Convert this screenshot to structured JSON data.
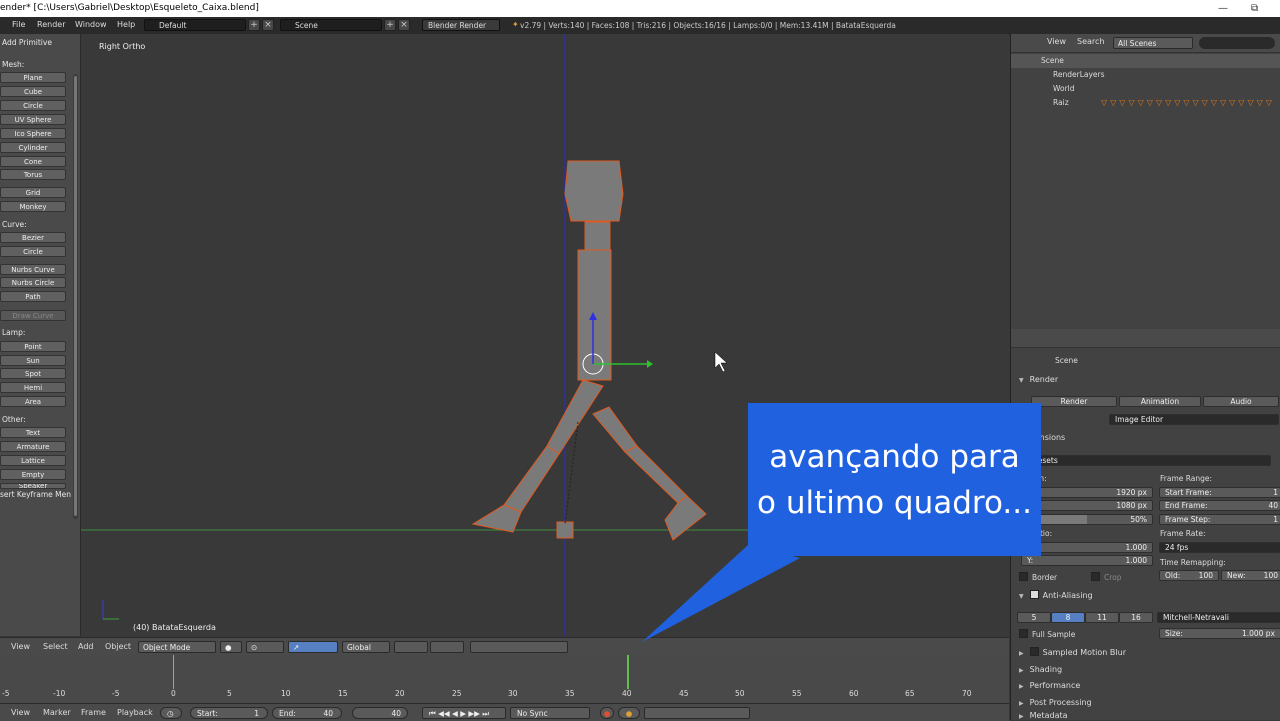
{
  "window": {
    "title": "ender* [C:\\Users\\Gabriel\\Desktop\\Esqueleto_Caixa.blend]",
    "minimize": "—",
    "restore": "⧉"
  },
  "topbar": {
    "menus": [
      "File",
      "Render",
      "Window",
      "Help"
    ],
    "layout": "Default",
    "scene": "Scene",
    "engine": "Blender Render",
    "stats": "v2.79 | Verts:140 | Faces:108 | Tris:216 | Objects:16/16 | Lamps:0/0 | Mem:13.41M | BatataEsquerda"
  },
  "toolshelf": {
    "title": "Add Primitive",
    "mesh_label": "Mesh:",
    "mesh": [
      "Plane",
      "Cube",
      "Circle",
      "UV Sphere",
      "Ico Sphere",
      "Cylinder",
      "Cone",
      "Torus",
      "Grid",
      "Monkey"
    ],
    "curve_label": "Curve:",
    "curve": [
      "Bezier",
      "Circle",
      "Nurbs Curve",
      "Nurbs Circle",
      "Path",
      "Draw Curve"
    ],
    "lamp_label": "Lamp:",
    "lamp": [
      "Point",
      "Sun",
      "Spot",
      "Hemi",
      "Area"
    ],
    "other_label": "Other:",
    "other": [
      "Text",
      "Armature",
      "Lattice",
      "Empty",
      "Speaker"
    ],
    "footer": "sert Keyframe Men"
  },
  "viewport": {
    "view_name": "Right Ortho",
    "object_info": "(40) BatataEsquerda"
  },
  "view_header": {
    "menus": [
      "View",
      "Select",
      "Add",
      "Object"
    ],
    "mode": "Object Mode",
    "orientation": "Global"
  },
  "timeline": {
    "ticks": [
      "-5",
      "-10",
      "-5",
      "0",
      "5",
      "10",
      "15",
      "20",
      "25",
      "30",
      "35",
      "40",
      "45",
      "50",
      "55",
      "60",
      "65",
      "70"
    ],
    "menus": [
      "View",
      "Marker",
      "Frame",
      "Playback"
    ],
    "start_label": "Start:",
    "start_value": "1",
    "end_label": "End:",
    "end_value": "40",
    "current": "40",
    "sync": "No Sync"
  },
  "outliner": {
    "menus": [
      "View",
      "Search"
    ],
    "filter": "All Scenes",
    "items": [
      "Scene",
      "RenderLayers",
      "World",
      "Raiz"
    ]
  },
  "properties": {
    "context": "Scene",
    "render_section": "Render",
    "render_buttons": [
      "Render",
      "Animation",
      "Audio"
    ],
    "display_label": "y:",
    "display_value": "Image Editor",
    "dimensions": "nensions",
    "presets": "r Presets",
    "resolution_label": "ution:",
    "res_x": "1920 px",
    "res_y": "1080 px",
    "res_pct": "50%",
    "frame_range_label": "Frame Range:",
    "start_frame": "Start Frame:",
    "start_frame_value": "1",
    "end_frame": "End Frame:",
    "end_frame_value": "40",
    "frame_step": "Frame Step:",
    "frame_step_value": "1",
    "aspect_label": "t Ratio:",
    "aspect_x": "1.000",
    "aspect_y_label": "Y:",
    "aspect_y": "1.000",
    "frame_rate_label": "Frame Rate:",
    "frame_rate": "24 fps",
    "remap_label": "Time Remapping:",
    "old_label": "Old:",
    "old_value": "100",
    "new_label": "New:",
    "new_value": "100",
    "border": "Border",
    "crop": "Crop",
    "antialiasing": "Anti-Aliasing",
    "aa_samples": [
      "5",
      "8",
      "11",
      "16"
    ],
    "aa_filter": "Mitchell-Netravali",
    "full_sample": "Full Sample",
    "size_label": "Size:",
    "size_value": "1.000 px",
    "sections": [
      "Sampled Motion Blur",
      "Shading",
      "Performance",
      "Post Processing",
      "Metadata"
    ]
  },
  "callout": {
    "line1": "avançando para",
    "line2": "o ultimo quadro..."
  },
  "colors": {
    "callout": "#2061e0",
    "selection": "#e05a20",
    "axis_x": "#3f8f3f",
    "axis_z": "#2c2cd0"
  }
}
